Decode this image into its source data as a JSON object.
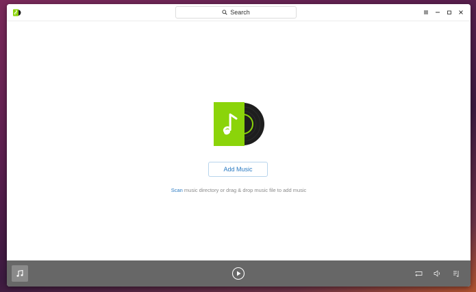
{
  "search": {
    "placeholder": "Search"
  },
  "empty_state": {
    "add_button_label": "Add Music",
    "hint_link": "Scan",
    "hint_text": " music directory or drag & drop music file to add music"
  },
  "icons": {
    "app_logo": "music-app-logo-icon",
    "search": "search-icon",
    "menu": "menu-icon",
    "minimize": "minimize-icon",
    "maximize": "maximize-icon",
    "close": "close-icon",
    "album": "album-vinyl-icon",
    "cover": "music-note-icon",
    "play": "play-icon",
    "repeat": "repeat-icon",
    "volume": "volume-icon",
    "playlist": "playlist-icon"
  },
  "colors": {
    "accent": "#2a7ac2",
    "album_green": "#8bd40a",
    "playbar_bg": "#676767"
  }
}
